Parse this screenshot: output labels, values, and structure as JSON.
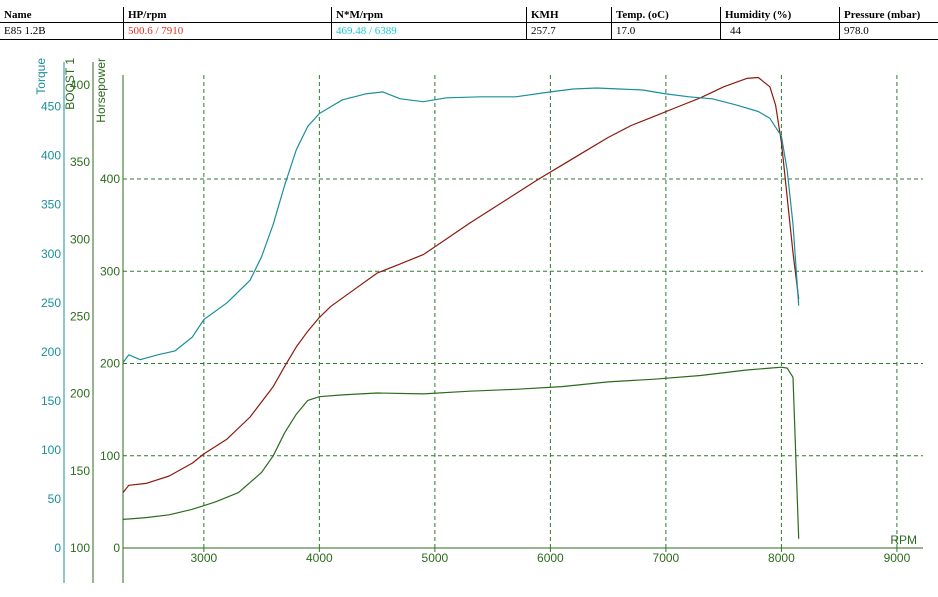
{
  "header": {
    "columns": [
      {
        "heading": "Name",
        "value": "E85 1.2B",
        "value_color": "#000000"
      },
      {
        "heading": "HP/rpm",
        "value": "500.6 / 7910",
        "value_color": "#e03020"
      },
      {
        "heading": "N*M/rpm",
        "value": "469.48 / 6389",
        "value_color": "#1fc7d6"
      },
      {
        "heading": "KMH",
        "value": "257.7",
        "value_color": "#000000"
      },
      {
        "heading": "Temp. (oC)",
        "value": "17.0",
        "value_color": "#000000"
      },
      {
        "heading": "Humidity (%)",
        "value": "44",
        "value_color": "#000000"
      },
      {
        "heading": "Pressure (mbar)",
        "value": "978.0",
        "value_color": "#000000"
      }
    ]
  },
  "chart_data": {
    "type": "line",
    "xlabel": "RPM",
    "xlim": [
      2300,
      9000
    ],
    "x_ticks": [
      3000,
      4000,
      5000,
      6000,
      7000,
      8000,
      9000
    ],
    "grid": true,
    "axes": {
      "hp": {
        "label": "Horsepower",
        "color": "#2d6a1e",
        "lim": [
          0,
          400
        ],
        "ticks": [
          0,
          100,
          200,
          300,
          400
        ]
      },
      "torque": {
        "label": "Torque",
        "color": "#1a8f9c",
        "lim": [
          0,
          480
        ],
        "ticks": [
          0,
          50,
          100,
          150,
          200,
          250,
          300,
          350,
          400,
          450
        ]
      },
      "boost": {
        "label": "BOOST 1",
        "color": "#2d6a1e",
        "lim": [
          100,
          400
        ],
        "ticks": [
          100,
          150,
          200,
          250,
          300,
          350,
          400
        ]
      }
    },
    "series": [
      {
        "axis": "hp",
        "color": "#8b1a0d",
        "x": [
          2300,
          2350,
          2500,
          2700,
          2900,
          3000,
          3200,
          3400,
          3600,
          3700,
          3800,
          3900,
          4000,
          4100,
          4300,
          4500,
          4700,
          4900,
          5100,
          5300,
          5500,
          5700,
          5900,
          6100,
          6300,
          6500,
          6700,
          6900,
          7100,
          7300,
          7500,
          7700,
          7800,
          7900,
          7950,
          8000,
          8050,
          8100,
          8150
        ],
        "y": [
          60,
          68,
          70,
          78,
          92,
          102,
          118,
          142,
          175,
          197,
          218,
          235,
          250,
          262,
          280,
          298,
          308,
          318,
          335,
          352,
          368,
          384,
          400,
          415,
          430,
          445,
          458,
          468,
          478,
          488,
          500,
          509,
          510,
          500,
          480,
          440,
          380,
          320,
          270
        ]
      },
      {
        "axis": "torque",
        "color": "#1a8f9c",
        "x": [
          2300,
          2350,
          2450,
          2600,
          2750,
          2900,
          3000,
          3200,
          3400,
          3500,
          3600,
          3700,
          3800,
          3900,
          4000,
          4200,
          4400,
          4550,
          4700,
          4900,
          5100,
          5400,
          5700,
          6000,
          6200,
          6400,
          6600,
          6800,
          7000,
          7200,
          7400,
          7600,
          7800,
          7900,
          8000,
          8050,
          8100,
          8150
        ],
        "y": [
          189,
          197,
          192,
          197,
          201,
          215,
          233,
          250,
          273,
          297,
          330,
          370,
          406,
          430,
          443,
          457,
          463,
          465,
          458,
          455,
          459,
          460,
          460,
          465,
          468,
          469,
          468,
          467,
          463,
          460,
          458,
          452,
          445,
          438,
          420,
          385,
          330,
          247
        ]
      },
      {
        "axis": "hp",
        "color": "#2d6a1e",
        "x": [
          2300,
          2500,
          2700,
          2900,
          3100,
          3300,
          3500,
          3600,
          3700,
          3800,
          3900,
          4000,
          4200,
          4500,
          4900,
          5300,
          5700,
          6100,
          6500,
          6900,
          7300,
          7700,
          7900,
          8000,
          8050,
          8100,
          8150
        ],
        "y": [
          31,
          33,
          36,
          42,
          50,
          60,
          82,
          100,
          125,
          145,
          160,
          164,
          166,
          168,
          167,
          170,
          172,
          175,
          180,
          183,
          187,
          193,
          195,
          196,
          195,
          185,
          10
        ]
      }
    ]
  }
}
